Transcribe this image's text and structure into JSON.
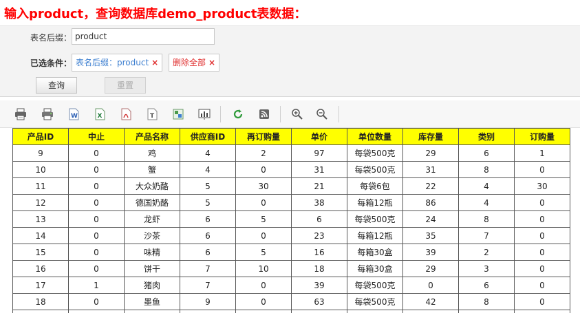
{
  "heading": "输入product，查询数据库demo_product表数据：",
  "query": {
    "suffix_label": "表名后缀：",
    "suffix_value": "product",
    "conditions_label": "已选条件：",
    "condition_chip": "表名后缀：product",
    "clear_all_chip": "删除全部",
    "remove_glyph": "×",
    "query_button": "查询",
    "reset_button": "重置"
  },
  "toolbar": {
    "icons": [
      "print-icon",
      "print-preview-icon",
      "export-word-icon",
      "export-excel-icon",
      "export-pdf-icon",
      "export-text-icon",
      "export-image-icon",
      "chart-icon",
      "refresh-icon",
      "rss-icon",
      "zoom-in-icon",
      "zoom-out-icon"
    ]
  },
  "table": {
    "columns": [
      "产品ID",
      "中止",
      "产品名称",
      "供应商ID",
      "再订购量",
      "单价",
      "单位数量",
      "库存量",
      "类别",
      "订购量"
    ],
    "rows": [
      [
        "9",
        "0",
        "鸡",
        "4",
        "2",
        "97",
        "每袋500克",
        "29",
        "6",
        "1"
      ],
      [
        "10",
        "0",
        "蟹",
        "4",
        "0",
        "31",
        "每袋500克",
        "31",
        "8",
        "0"
      ],
      [
        "11",
        "0",
        "大众奶酪",
        "5",
        "30",
        "21",
        "每袋6包",
        "22",
        "4",
        "30"
      ],
      [
        "12",
        "0",
        "德国奶酪",
        "5",
        "0",
        "38",
        "每箱12瓶",
        "86",
        "4",
        "0"
      ],
      [
        "13",
        "0",
        "龙虾",
        "6",
        "5",
        "6",
        "每袋500克",
        "24",
        "8",
        "0"
      ],
      [
        "14",
        "0",
        "沙茶",
        "6",
        "0",
        "23",
        "每箱12瓶",
        "35",
        "7",
        "0"
      ],
      [
        "15",
        "0",
        "味精",
        "6",
        "5",
        "16",
        "每箱30盒",
        "39",
        "2",
        "0"
      ],
      [
        "16",
        "0",
        "饼干",
        "7",
        "10",
        "18",
        "每箱30盒",
        "29",
        "3",
        "0"
      ],
      [
        "17",
        "1",
        "猪肉",
        "7",
        "0",
        "39",
        "每袋500克",
        "0",
        "6",
        "0"
      ],
      [
        "18",
        "0",
        "墨鱼",
        "9",
        "0",
        "63",
        "每袋500克",
        "42",
        "8",
        "0"
      ],
      [
        "",
        "",
        "",
        "",
        "",
        "",
        "",
        "",
        "",
        ""
      ]
    ]
  }
}
